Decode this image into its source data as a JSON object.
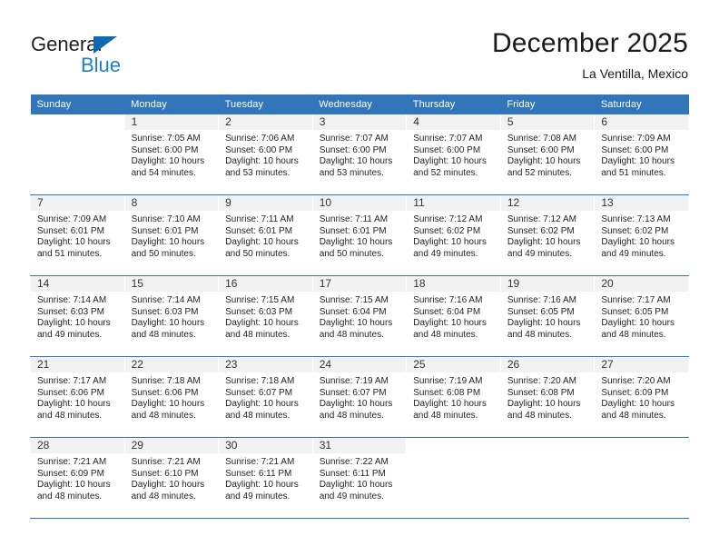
{
  "brand": {
    "name_dark": "General",
    "name_blue": "Blue",
    "color_dark": "#231f20",
    "color_blue": "#1b7fd4",
    "triangle_color": "#1068b3"
  },
  "header": {
    "title": "December 2025",
    "location": "La Ventilla, Mexico"
  },
  "theme": {
    "header_bg": "#3275b8",
    "header_text": "#ffffff",
    "daynum_bar_bg": "#f2f2f2",
    "row_divider": "#3275b8",
    "body_text": "#231f20"
  },
  "calendar": {
    "weekday_headers": [
      "Sunday",
      "Monday",
      "Tuesday",
      "Wednesday",
      "Thursday",
      "Friday",
      "Saturday"
    ],
    "weeks": [
      [
        {
          "day": "",
          "sunrise": "",
          "sunset": "",
          "daylight_1": "",
          "daylight_2": ""
        },
        {
          "day": "1",
          "sunrise": "Sunrise: 7:05 AM",
          "sunset": "Sunset: 6:00 PM",
          "daylight_1": "Daylight: 10 hours",
          "daylight_2": "and 54 minutes."
        },
        {
          "day": "2",
          "sunrise": "Sunrise: 7:06 AM",
          "sunset": "Sunset: 6:00 PM",
          "daylight_1": "Daylight: 10 hours",
          "daylight_2": "and 53 minutes."
        },
        {
          "day": "3",
          "sunrise": "Sunrise: 7:07 AM",
          "sunset": "Sunset: 6:00 PM",
          "daylight_1": "Daylight: 10 hours",
          "daylight_2": "and 53 minutes."
        },
        {
          "day": "4",
          "sunrise": "Sunrise: 7:07 AM",
          "sunset": "Sunset: 6:00 PM",
          "daylight_1": "Daylight: 10 hours",
          "daylight_2": "and 52 minutes."
        },
        {
          "day": "5",
          "sunrise": "Sunrise: 7:08 AM",
          "sunset": "Sunset: 6:00 PM",
          "daylight_1": "Daylight: 10 hours",
          "daylight_2": "and 52 minutes."
        },
        {
          "day": "6",
          "sunrise": "Sunrise: 7:09 AM",
          "sunset": "Sunset: 6:00 PM",
          "daylight_1": "Daylight: 10 hours",
          "daylight_2": "and 51 minutes."
        }
      ],
      [
        {
          "day": "7",
          "sunrise": "Sunrise: 7:09 AM",
          "sunset": "Sunset: 6:01 PM",
          "daylight_1": "Daylight: 10 hours",
          "daylight_2": "and 51 minutes."
        },
        {
          "day": "8",
          "sunrise": "Sunrise: 7:10 AM",
          "sunset": "Sunset: 6:01 PM",
          "daylight_1": "Daylight: 10 hours",
          "daylight_2": "and 50 minutes."
        },
        {
          "day": "9",
          "sunrise": "Sunrise: 7:11 AM",
          "sunset": "Sunset: 6:01 PM",
          "daylight_1": "Daylight: 10 hours",
          "daylight_2": "and 50 minutes."
        },
        {
          "day": "10",
          "sunrise": "Sunrise: 7:11 AM",
          "sunset": "Sunset: 6:01 PM",
          "daylight_1": "Daylight: 10 hours",
          "daylight_2": "and 50 minutes."
        },
        {
          "day": "11",
          "sunrise": "Sunrise: 7:12 AM",
          "sunset": "Sunset: 6:02 PM",
          "daylight_1": "Daylight: 10 hours",
          "daylight_2": "and 49 minutes."
        },
        {
          "day": "12",
          "sunrise": "Sunrise: 7:12 AM",
          "sunset": "Sunset: 6:02 PM",
          "daylight_1": "Daylight: 10 hours",
          "daylight_2": "and 49 minutes."
        },
        {
          "day": "13",
          "sunrise": "Sunrise: 7:13 AM",
          "sunset": "Sunset: 6:02 PM",
          "daylight_1": "Daylight: 10 hours",
          "daylight_2": "and 49 minutes."
        }
      ],
      [
        {
          "day": "14",
          "sunrise": "Sunrise: 7:14 AM",
          "sunset": "Sunset: 6:03 PM",
          "daylight_1": "Daylight: 10 hours",
          "daylight_2": "and 49 minutes."
        },
        {
          "day": "15",
          "sunrise": "Sunrise: 7:14 AM",
          "sunset": "Sunset: 6:03 PM",
          "daylight_1": "Daylight: 10 hours",
          "daylight_2": "and 48 minutes."
        },
        {
          "day": "16",
          "sunrise": "Sunrise: 7:15 AM",
          "sunset": "Sunset: 6:03 PM",
          "daylight_1": "Daylight: 10 hours",
          "daylight_2": "and 48 minutes."
        },
        {
          "day": "17",
          "sunrise": "Sunrise: 7:15 AM",
          "sunset": "Sunset: 6:04 PM",
          "daylight_1": "Daylight: 10 hours",
          "daylight_2": "and 48 minutes."
        },
        {
          "day": "18",
          "sunrise": "Sunrise: 7:16 AM",
          "sunset": "Sunset: 6:04 PM",
          "daylight_1": "Daylight: 10 hours",
          "daylight_2": "and 48 minutes."
        },
        {
          "day": "19",
          "sunrise": "Sunrise: 7:16 AM",
          "sunset": "Sunset: 6:05 PM",
          "daylight_1": "Daylight: 10 hours",
          "daylight_2": "and 48 minutes."
        },
        {
          "day": "20",
          "sunrise": "Sunrise: 7:17 AM",
          "sunset": "Sunset: 6:05 PM",
          "daylight_1": "Daylight: 10 hours",
          "daylight_2": "and 48 minutes."
        }
      ],
      [
        {
          "day": "21",
          "sunrise": "Sunrise: 7:17 AM",
          "sunset": "Sunset: 6:06 PM",
          "daylight_1": "Daylight: 10 hours",
          "daylight_2": "and 48 minutes."
        },
        {
          "day": "22",
          "sunrise": "Sunrise: 7:18 AM",
          "sunset": "Sunset: 6:06 PM",
          "daylight_1": "Daylight: 10 hours",
          "daylight_2": "and 48 minutes."
        },
        {
          "day": "23",
          "sunrise": "Sunrise: 7:18 AM",
          "sunset": "Sunset: 6:07 PM",
          "daylight_1": "Daylight: 10 hours",
          "daylight_2": "and 48 minutes."
        },
        {
          "day": "24",
          "sunrise": "Sunrise: 7:19 AM",
          "sunset": "Sunset: 6:07 PM",
          "daylight_1": "Daylight: 10 hours",
          "daylight_2": "and 48 minutes."
        },
        {
          "day": "25",
          "sunrise": "Sunrise: 7:19 AM",
          "sunset": "Sunset: 6:08 PM",
          "daylight_1": "Daylight: 10 hours",
          "daylight_2": "and 48 minutes."
        },
        {
          "day": "26",
          "sunrise": "Sunrise: 7:20 AM",
          "sunset": "Sunset: 6:08 PM",
          "daylight_1": "Daylight: 10 hours",
          "daylight_2": "and 48 minutes."
        },
        {
          "day": "27",
          "sunrise": "Sunrise: 7:20 AM",
          "sunset": "Sunset: 6:09 PM",
          "daylight_1": "Daylight: 10 hours",
          "daylight_2": "and 48 minutes."
        }
      ],
      [
        {
          "day": "28",
          "sunrise": "Sunrise: 7:21 AM",
          "sunset": "Sunset: 6:09 PM",
          "daylight_1": "Daylight: 10 hours",
          "daylight_2": "and 48 minutes."
        },
        {
          "day": "29",
          "sunrise": "Sunrise: 7:21 AM",
          "sunset": "Sunset: 6:10 PM",
          "daylight_1": "Daylight: 10 hours",
          "daylight_2": "and 48 minutes."
        },
        {
          "day": "30",
          "sunrise": "Sunrise: 7:21 AM",
          "sunset": "Sunset: 6:11 PM",
          "daylight_1": "Daylight: 10 hours",
          "daylight_2": "and 49 minutes."
        },
        {
          "day": "31",
          "sunrise": "Sunrise: 7:22 AM",
          "sunset": "Sunset: 6:11 PM",
          "daylight_1": "Daylight: 10 hours",
          "daylight_2": "and 49 minutes."
        },
        {
          "day": "",
          "sunrise": "",
          "sunset": "",
          "daylight_1": "",
          "daylight_2": ""
        },
        {
          "day": "",
          "sunrise": "",
          "sunset": "",
          "daylight_1": "",
          "daylight_2": ""
        },
        {
          "day": "",
          "sunrise": "",
          "sunset": "",
          "daylight_1": "",
          "daylight_2": ""
        }
      ]
    ]
  }
}
